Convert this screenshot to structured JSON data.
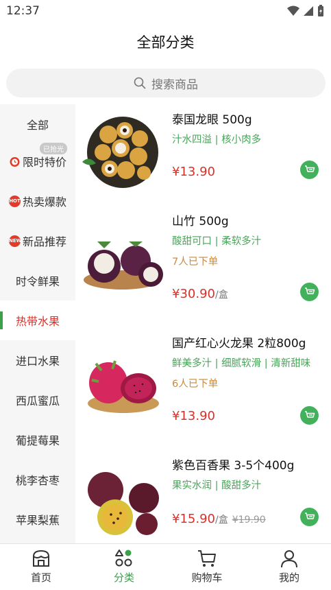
{
  "status": {
    "time": "12:37"
  },
  "header": {
    "title": "全部分类"
  },
  "search": {
    "placeholder": "搜索商品"
  },
  "sidebar": {
    "items": [
      {
        "label": "全部"
      },
      {
        "label": "限时特价",
        "tag": "已抢光",
        "icon": "alarm-clock-icon"
      },
      {
        "label": "热卖爆款",
        "icon": "hot-fire-icon",
        "icon_text": "HOT"
      },
      {
        "label": "新品推荐",
        "icon": "new-badge-icon",
        "icon_text": "NEW"
      },
      {
        "label": "时令鲜果"
      },
      {
        "label": "热带水果",
        "active": true
      },
      {
        "label": "进口水果"
      },
      {
        "label": "西瓜蜜瓜"
      },
      {
        "label": "葡提莓果"
      },
      {
        "label": "桃李杏枣"
      },
      {
        "label": "苹果梨蕉"
      }
    ]
  },
  "products": [
    {
      "name": "泰国龙眼 500g",
      "tags": "汁水四溢 | 核小肉多",
      "sold": "",
      "price": "¥13.90",
      "unit": "",
      "original_price": ""
    },
    {
      "name": "山竹 500g",
      "tags": "酸甜可口 | 柔软多汁",
      "sold": "7人已下单",
      "price": "¥30.90",
      "unit": "/盒",
      "original_price": ""
    },
    {
      "name": "国产红心火龙果 2粒800g",
      "tags": "鲜美多汁 | 细腻软滑 | 清新甜味",
      "sold": "6人已下单",
      "price": "¥13.90",
      "unit": "",
      "original_price": ""
    },
    {
      "name": "紫色百香果 3-5个400g",
      "tags": "果实水润 | 酸甜多汁",
      "sold": "",
      "price": "¥15.90",
      "unit": "/盒",
      "original_price": "¥19.90"
    }
  ],
  "tabbar": {
    "items": [
      {
        "label": "首页",
        "icon": "shop-home-icon"
      },
      {
        "label": "分类",
        "icon": "category-icon",
        "active": true
      },
      {
        "label": "购物车",
        "icon": "cart-icon"
      },
      {
        "label": "我的",
        "icon": "user-icon"
      }
    ]
  },
  "colors": {
    "accent_green": "#3aa04a",
    "price_red": "#d9302a",
    "tag_green": "#4aa35a",
    "sold_orange": "#c98a3d"
  }
}
